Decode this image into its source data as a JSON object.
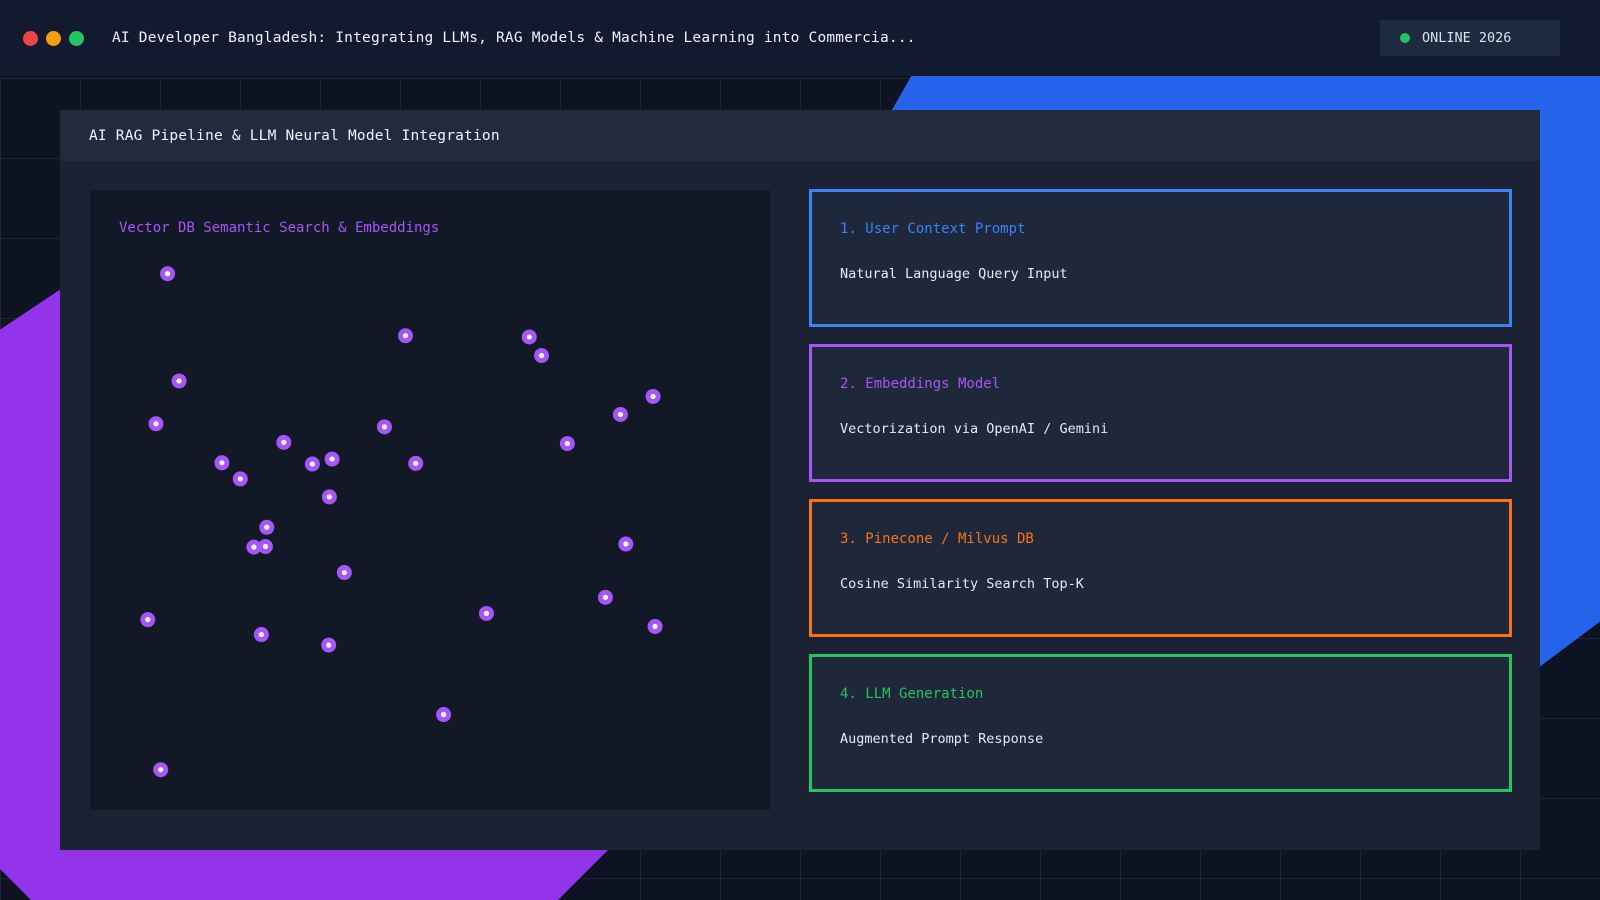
{
  "window": {
    "title": "AI Developer Bangladesh: Integrating LLMs, RAG Models & Machine Learning into Commercia...",
    "status": "ONLINE 2026"
  },
  "panel": {
    "title": "AI RAG Pipeline & LLM Neural Model Integration"
  },
  "scatter": {
    "title": "Vector DB Semantic Search & Embeddings",
    "point_color": "#a855f7",
    "points": [
      [
        0.114,
        0.135
      ],
      [
        0.464,
        0.235
      ],
      [
        0.646,
        0.237
      ],
      [
        0.664,
        0.267
      ],
      [
        0.131,
        0.308
      ],
      [
        0.828,
        0.333
      ],
      [
        0.78,
        0.362
      ],
      [
        0.097,
        0.377
      ],
      [
        0.433,
        0.382
      ],
      [
        0.702,
        0.409
      ],
      [
        0.285,
        0.407
      ],
      [
        0.194,
        0.44
      ],
      [
        0.221,
        0.466
      ],
      [
        0.327,
        0.442
      ],
      [
        0.356,
        0.434
      ],
      [
        0.479,
        0.441
      ],
      [
        0.352,
        0.495
      ],
      [
        0.26,
        0.544
      ],
      [
        0.241,
        0.576
      ],
      [
        0.258,
        0.575
      ],
      [
        0.788,
        0.571
      ],
      [
        0.374,
        0.617
      ],
      [
        0.758,
        0.657
      ],
      [
        0.583,
        0.683
      ],
      [
        0.085,
        0.693
      ],
      [
        0.831,
        0.704
      ],
      [
        0.252,
        0.717
      ],
      [
        0.351,
        0.734
      ],
      [
        0.52,
        0.846
      ],
      [
        0.104,
        0.935
      ]
    ]
  },
  "pipeline": [
    {
      "title": "1. User Context Prompt",
      "desc": "Natural Language Query Input",
      "color": "#3b82f6"
    },
    {
      "title": "2. Embeddings Model",
      "desc": "Vectorization via OpenAI / Gemini",
      "color": "#a855f7"
    },
    {
      "title": "3. Pinecone / Milvus DB",
      "desc": "Cosine Similarity Search Top-K",
      "color": "#f97316"
    },
    {
      "title": "4. LLM Generation",
      "desc": "Augmented Prompt Response",
      "color": "#22c55e"
    }
  ]
}
